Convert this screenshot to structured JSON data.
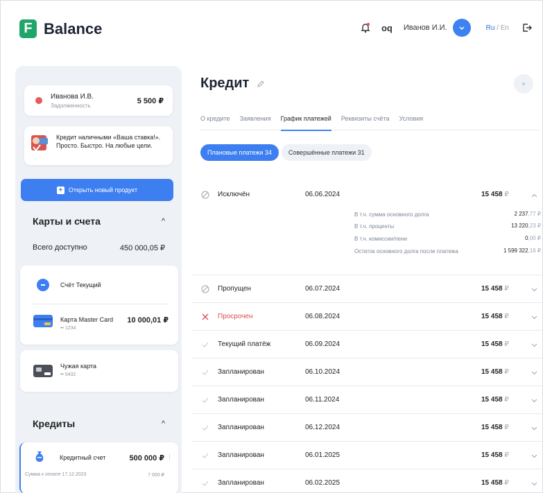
{
  "header": {
    "brand": "Balance",
    "logo_letter": "F",
    "user_name": "Иванов И.И.",
    "lang_active": "Ru",
    "lang_sep": " / ",
    "lang_other": "En",
    "glasses_glyph": "oq"
  },
  "sidebar": {
    "debt": {
      "name": "Иванова И.В.",
      "subtitle": "Задолженность",
      "amount": "5 500 ₽"
    },
    "promo": {
      "text": "Кредит наличными «Ваша ставка!». Просто. Быстро. На любые цели."
    },
    "open_button": {
      "plus": "+",
      "label": "Открыть новый продукт"
    },
    "cards_section": {
      "title": "Карты и счета",
      "chevron": "^"
    },
    "available": {
      "label": "Всего доступно",
      "amount": "450 000,05 ₽"
    },
    "accounts": [
      {
        "label": "Счёт Текущий"
      },
      {
        "label": "Карта Master Card",
        "number": "•• 1234",
        "amount": "10 000,01 ₽"
      }
    ],
    "alien_card": {
      "label": "Чужая карта",
      "number": "•• 5432"
    },
    "credits_section": {
      "title": "Кредиты",
      "chevron": "^"
    },
    "credit_account": {
      "label": "Кредитный счет",
      "amount": "500 000 ₽",
      "menu": "⋮",
      "due_label": "Сумма к оплате 17.12.2023",
      "due_amount": "7 000 ₽"
    }
  },
  "main": {
    "title": "Кредит",
    "close_glyph": "×",
    "tabs": [
      "О кредите",
      "Заявления",
      "График платежей",
      "Реквизиты счёта",
      "Условия"
    ],
    "active_tab_index": 2,
    "chips": [
      {
        "label": "Плановые платежи 34",
        "active": true
      },
      {
        "label": "Совершённые платежи 31",
        "active": false
      }
    ],
    "payments": [
      {
        "status": "Исключён",
        "icon": "excluded-icon",
        "date": "06.06.2024",
        "amount": "15 458",
        "currency": "₽",
        "expanded": true
      },
      {
        "status": "Пропущен",
        "icon": "skipped-icon",
        "date": "06.07.2024",
        "amount": "15 458",
        "currency": "₽"
      },
      {
        "status": "Просрочен",
        "icon": "overdue-icon",
        "date": "06.08.2024",
        "amount": "15 458",
        "currency": "₽"
      },
      {
        "status": "Текущий платёж",
        "icon": "check-icon",
        "date": "06.09.2024",
        "amount": "15 458",
        "currency": "₽"
      },
      {
        "status": "Запланирован",
        "icon": "check-icon",
        "date": "06.10.2024",
        "amount": "15 458",
        "currency": "₽"
      },
      {
        "status": "Запланирован",
        "icon": "check-icon",
        "date": "06.11.2024",
        "amount": "15 458",
        "currency": "₽"
      },
      {
        "status": "Запланирован",
        "icon": "check-icon",
        "date": "06.12.2024",
        "amount": "15 458",
        "currency": "₽"
      },
      {
        "status": "Запланирован",
        "icon": "check-icon",
        "date": "06.01.2025",
        "amount": "15 458",
        "currency": "₽"
      },
      {
        "status": "Запланирован",
        "icon": "check-icon",
        "date": "06.02.2025",
        "amount": "15 458",
        "currency": "₽"
      }
    ],
    "details": [
      {
        "label": "В т.ч. сумма основного долга",
        "int": "2 237",
        "dec": ",77 ₽"
      },
      {
        "label": "В т.ч. проценты",
        "int": "13 220",
        "dec": ",23 ₽"
      },
      {
        "label": "В т.ч. комиссии/пени",
        "int": "0",
        "dec": ",00 ₽"
      },
      {
        "label": "Остаток основного долга после платежа",
        "int": "1 599 322",
        "dec": ",16 ₽"
      }
    ]
  },
  "colors": {
    "accent": "#3d7ff0",
    "brand_green": "#21a66a",
    "danger": "#e04b4b",
    "muted": "#9aa3b0"
  }
}
